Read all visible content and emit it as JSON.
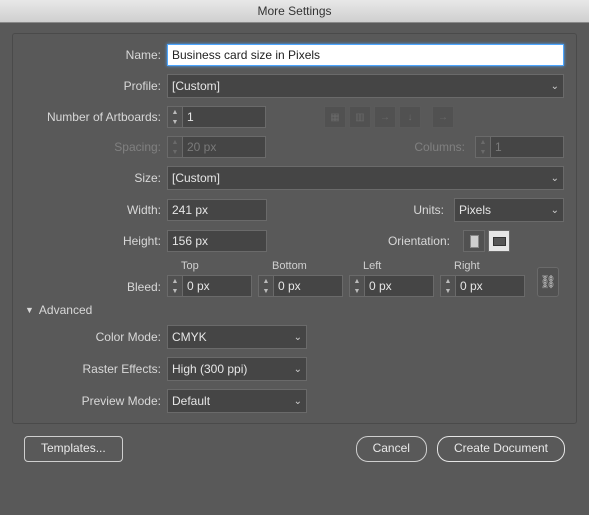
{
  "title": "More Settings",
  "labels": {
    "name": "Name:",
    "profile": "Profile:",
    "artboards": "Number of Artboards:",
    "spacing": "Spacing:",
    "columns": "Columns:",
    "size": "Size:",
    "width": "Width:",
    "height": "Height:",
    "units": "Units:",
    "orientation": "Orientation:",
    "bleed": "Bleed:",
    "top": "Top",
    "bottom": "Bottom",
    "left": "Left",
    "right": "Right",
    "advanced": "Advanced",
    "colorMode": "Color Mode:",
    "rasterEffects": "Raster Effects:",
    "previewMode": "Preview Mode:"
  },
  "values": {
    "name": "Business card size in Pixels",
    "profile": "[Custom]",
    "artboards": "1",
    "spacing": "20 px",
    "columns": "1",
    "size": "[Custom]",
    "width": "241 px",
    "height": "156 px",
    "units": "Pixels",
    "bleedTop": "0 px",
    "bleedBottom": "0 px",
    "bleedLeft": "0 px",
    "bleedRight": "0 px",
    "colorMode": "CMYK",
    "rasterEffects": "High (300 ppi)",
    "previewMode": "Default"
  },
  "buttons": {
    "templates": "Templates...",
    "cancel": "Cancel",
    "create": "Create Document"
  }
}
